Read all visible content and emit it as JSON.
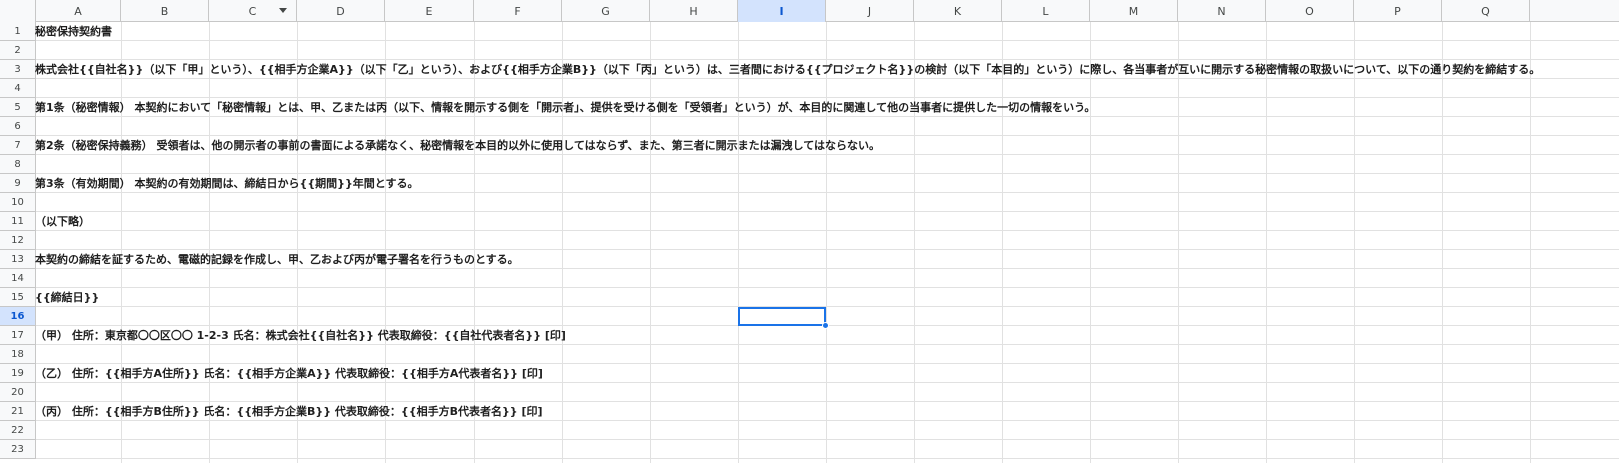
{
  "columns": [
    "A",
    "B",
    "C",
    "D",
    "E",
    "F",
    "G",
    "H",
    "I",
    "J",
    "K",
    "L",
    "M",
    "N",
    "O",
    "P",
    "Q"
  ],
  "active_column": "I",
  "active_row": "16",
  "rows": [
    {
      "num": "1",
      "text": "秘密保持契約書"
    },
    {
      "num": "2",
      "text": ""
    },
    {
      "num": "3",
      "text": "株式会社{{自社名}}（以下「甲」という）、{{相手方企業A}}（以下「乙」という）、および{{相手方企業B}}（以下「丙」という）は、三者間における{{プロジェクト名}}の検討（以下「本目的」という）に際し、各当事者が互いに開示する秘密情報の取扱いについて、以下の通り契約を締結する。"
    },
    {
      "num": "4",
      "text": ""
    },
    {
      "num": "5",
      "text": "第1条（秘密情報） 本契約において「秘密情報」とは、甲、乙または丙（以下、情報を開示する側を「開示者」、提供を受ける側を「受領者」という）が、本目的に関連して他の当事者に提供した一切の情報をいう。"
    },
    {
      "num": "6",
      "text": ""
    },
    {
      "num": "7",
      "text": "第2条（秘密保持義務） 受領者は、他の開示者の事前の書面による承諾なく、秘密情報を本目的以外に使用してはならず、また、第三者に開示または漏洩してはならない。"
    },
    {
      "num": "8",
      "text": ""
    },
    {
      "num": "9",
      "text": "第3条（有効期間） 本契約の有効期間は、締結日から{{期間}}年間とする。"
    },
    {
      "num": "10",
      "text": ""
    },
    {
      "num": "11",
      "text": "（以下略）"
    },
    {
      "num": "12",
      "text": ""
    },
    {
      "num": "13",
      "text": "本契約の締結を証するため、電磁的記録を作成し、甲、乙および丙が電子署名を行うものとする。"
    },
    {
      "num": "14",
      "text": ""
    },
    {
      "num": "15",
      "text": "{{締結日}}"
    },
    {
      "num": "16",
      "text": ""
    },
    {
      "num": "17",
      "text": "（甲） 住所：東京都〇〇区〇〇 1-2-3 氏名：株式会社{{自社名}} 代表取締役：{{自社代表者名}} [印]"
    },
    {
      "num": "18",
      "text": ""
    },
    {
      "num": "19",
      "text": "（乙） 住所：{{相手方A住所}} 氏名：{{相手方企業A}} 代表取締役：{{相手方A代表者名}} [印]"
    },
    {
      "num": "20",
      "text": ""
    },
    {
      "num": "21",
      "text": "（丙） 住所：{{相手方B住所}} 氏名：{{相手方企業B}} 代表取締役：{{相手方B代表者名}} [印]"
    },
    {
      "num": "22",
      "text": ""
    },
    {
      "num": "23",
      "text": ""
    }
  ],
  "colors": {
    "selection": "#1a73e8",
    "header_active": "#d3e3fd",
    "grid": "#e1e1e1"
  }
}
